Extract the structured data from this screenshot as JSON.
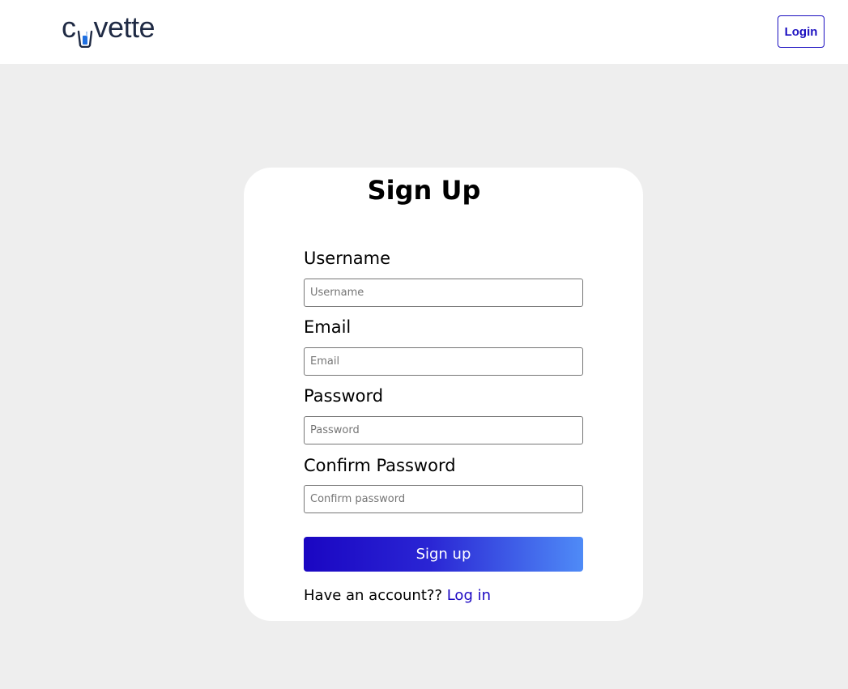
{
  "header": {
    "logo_prefix": "c",
    "logo_suffix": "vette",
    "login_label": "Login"
  },
  "form": {
    "title": "Sign Up",
    "fields": [
      {
        "label": "Username",
        "placeholder": "Username",
        "value": ""
      },
      {
        "label": "Email",
        "placeholder": "Email",
        "value": ""
      },
      {
        "label": "Password",
        "placeholder": "Password",
        "value": ""
      },
      {
        "label": "Confirm Password",
        "placeholder": "Confirm password",
        "value": ""
      }
    ],
    "submit_label": "Sign up",
    "footer_text": "Have an account?? ",
    "footer_link": "Log in"
  },
  "colors": {
    "accent": "#1a06c2",
    "page_background": "#eeeeee",
    "card_background": "#ffffff",
    "gradient_end": "#4f8bf7"
  },
  "icons": {
    "logo_mark": "cuvette-cup-icon"
  }
}
